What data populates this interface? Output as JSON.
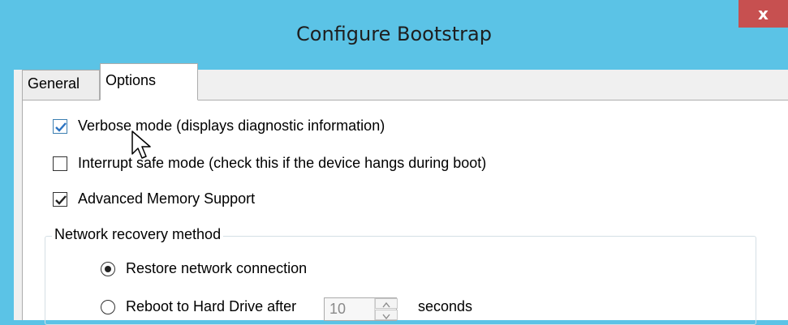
{
  "window": {
    "title": "Configure Bootstrap",
    "close_label": "x"
  },
  "tabs": [
    {
      "label": "General",
      "selected": false
    },
    {
      "label": "Options",
      "selected": true
    }
  ],
  "options": {
    "verbose": {
      "label": "Verbose mode (displays diagnostic information)",
      "checked": true
    },
    "interrupt_safe": {
      "label": "Interrupt safe mode (check this if the device hangs during boot)",
      "checked": false
    },
    "advanced_memory": {
      "label": "Advanced Memory Support",
      "checked": true
    }
  },
  "network_recovery": {
    "title": "Network recovery method",
    "restore": {
      "label": "Restore network connection",
      "selected": true
    },
    "reboot": {
      "label": "Reboot to Hard Drive after",
      "selected": false,
      "seconds_value": "10",
      "seconds_label": "seconds"
    }
  },
  "colors": {
    "title_bar": "#5bc3e6",
    "close_button": "#c75050",
    "check_accent": "#3c7fb1"
  },
  "icons": {
    "close": "close-icon",
    "checkmark": "checkmark-icon",
    "cursor": "mouse-pointer-icon",
    "spin_up": "spin-up-icon",
    "spin_down": "spin-down-icon"
  }
}
